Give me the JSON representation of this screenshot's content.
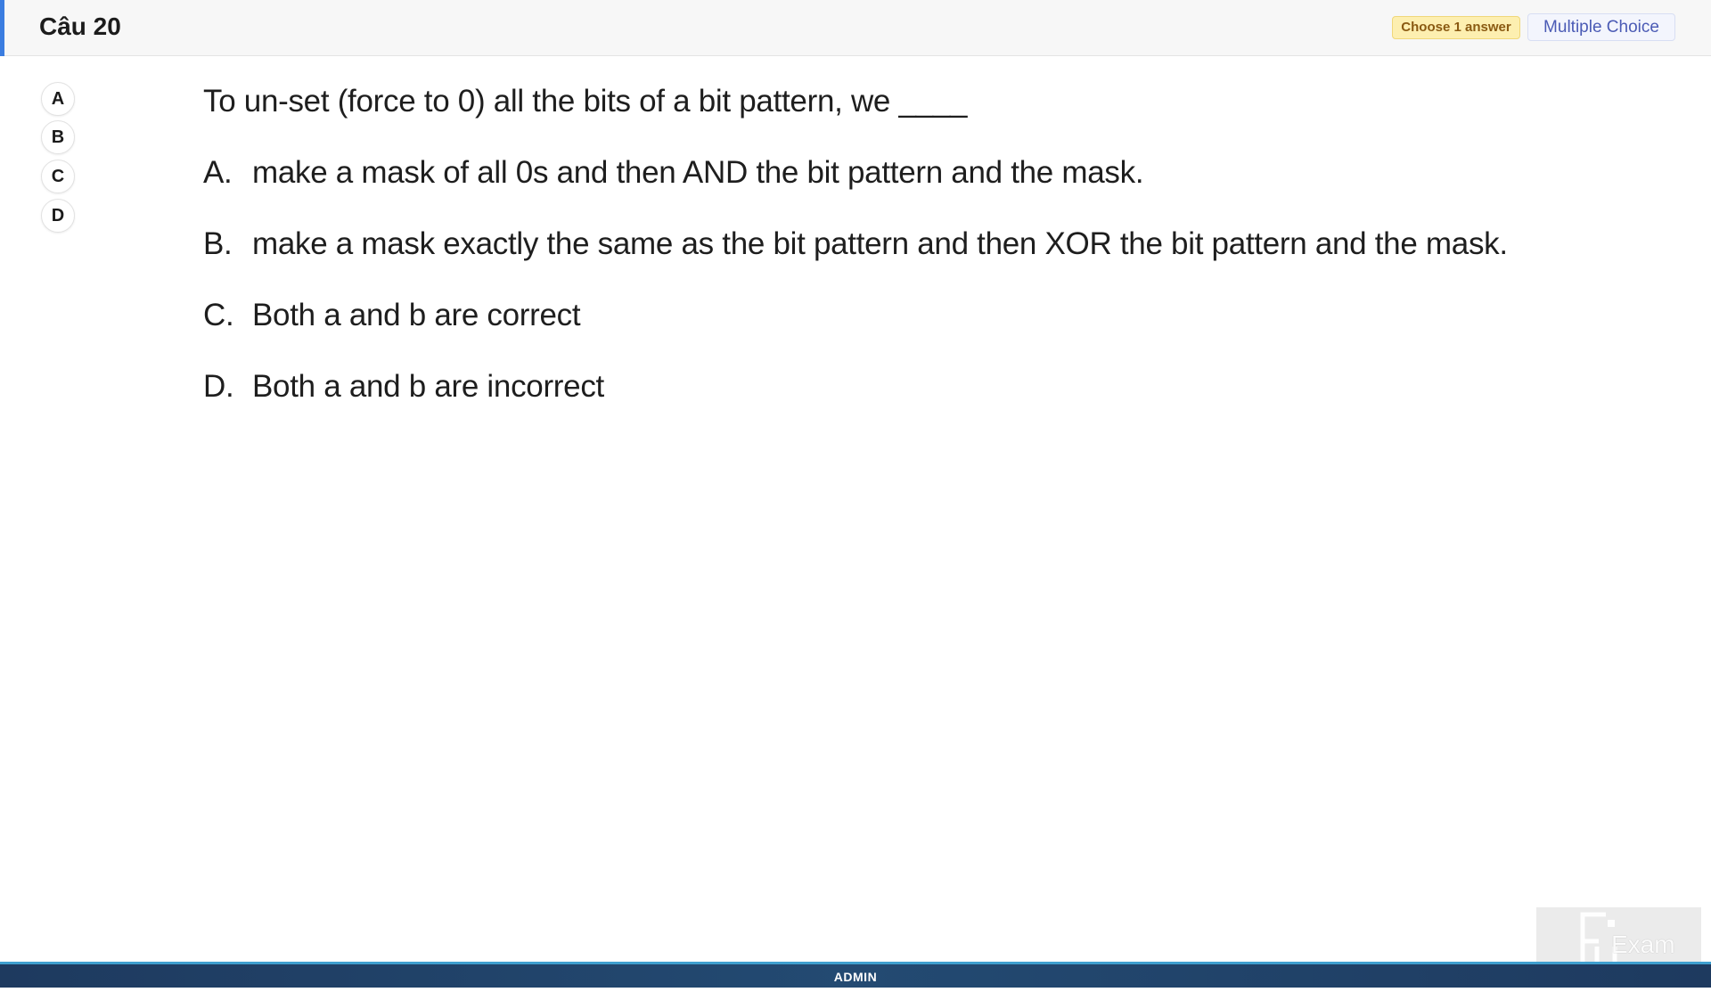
{
  "header": {
    "title": "Câu 20",
    "badge_choose": "Choose 1 answer",
    "badge_type": "Multiple Choice",
    "accent_color": "#3b7de0"
  },
  "options": [
    "A",
    "B",
    "C",
    "D"
  ],
  "question": {
    "stem": "To un-set (force to 0) all the bits of a bit pattern, we ____",
    "answers": [
      {
        "letter": "A.",
        "text": "make a mask of all 0s and then AND the bit pattern and the mask."
      },
      {
        "letter": "B.",
        "text": "make a mask exactly the same as the bit pattern and then XOR the bit pattern and the mask."
      },
      {
        "letter": "C.",
        "text": "Both a and b are correct"
      },
      {
        "letter": "D.",
        "text": "Both a and b are incorrect"
      }
    ]
  },
  "footer": {
    "label": "ADMIN"
  },
  "logo": {
    "text": "Exam",
    "icon": "fu-exam-logo-icon"
  }
}
